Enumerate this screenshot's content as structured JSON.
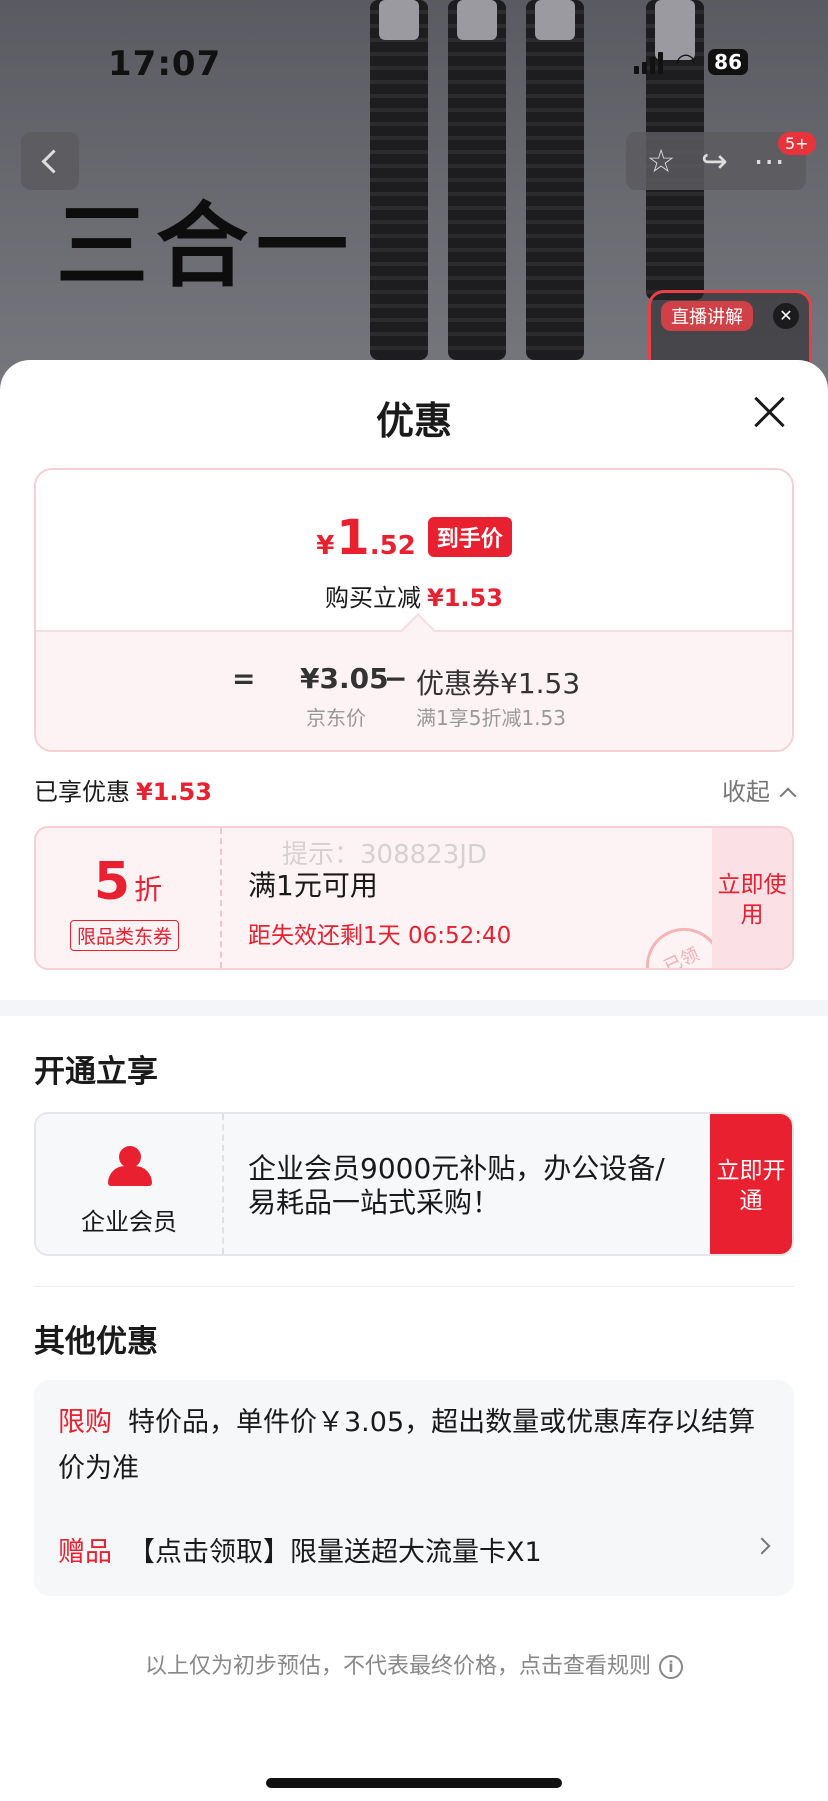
{
  "status_bar": {
    "time": "17:07",
    "battery": "86"
  },
  "header": {
    "badge": "5+"
  },
  "product_image": {
    "hero_text": "三合一",
    "live_label": "直播讲解",
    "live_close": "✕"
  },
  "sheet": {
    "title": "优惠"
  },
  "price_card": {
    "currency": "¥",
    "final_int": "1",
    "final_dec": ".52",
    "final_tag": "到手价",
    "reduce_label": "购买立减",
    "reduce_amount": "¥1.53",
    "equals": "=",
    "jd_price": "¥3.05",
    "minus": "−",
    "coupon_part": "优惠券¥1.53",
    "jd_price_label": "京东价",
    "coupon_rule": "满1享5折减1.53"
  },
  "enjoyed": {
    "label": "已享优惠",
    "amount": "¥1.53",
    "collapse": "收起"
  },
  "coupon": {
    "discount": "5",
    "discount_unit": "折",
    "type": "限品类东券",
    "condition": "满1元可用",
    "expire": "距失效还剩1天 06:52:40",
    "action": "立即使用",
    "stamp": "已领",
    "watermark": "提示：308823JD"
  },
  "vip_section": {
    "title": "开通立享",
    "label": "企业会员",
    "desc": "企业会员9000元补贴，办公设备/易耗品一站式采购！",
    "action": "立即开通"
  },
  "other_section": {
    "title": "其他优惠",
    "items": [
      {
        "tag": "限购",
        "text": "特价品，单件价￥3.05，超出数量或优惠库存以结算价为准"
      },
      {
        "tag": "赠品",
        "text": "【点击领取】限量送超大流量卡X1"
      }
    ]
  },
  "footnote": {
    "text": "以上仅为初步预估，不代表最终价格，点击查看规则",
    "icon": "i"
  },
  "colors": {
    "accent_red": "#e8202f",
    "pink_bg": "#fdf3f5",
    "border_pink": "#f6cfd6"
  }
}
